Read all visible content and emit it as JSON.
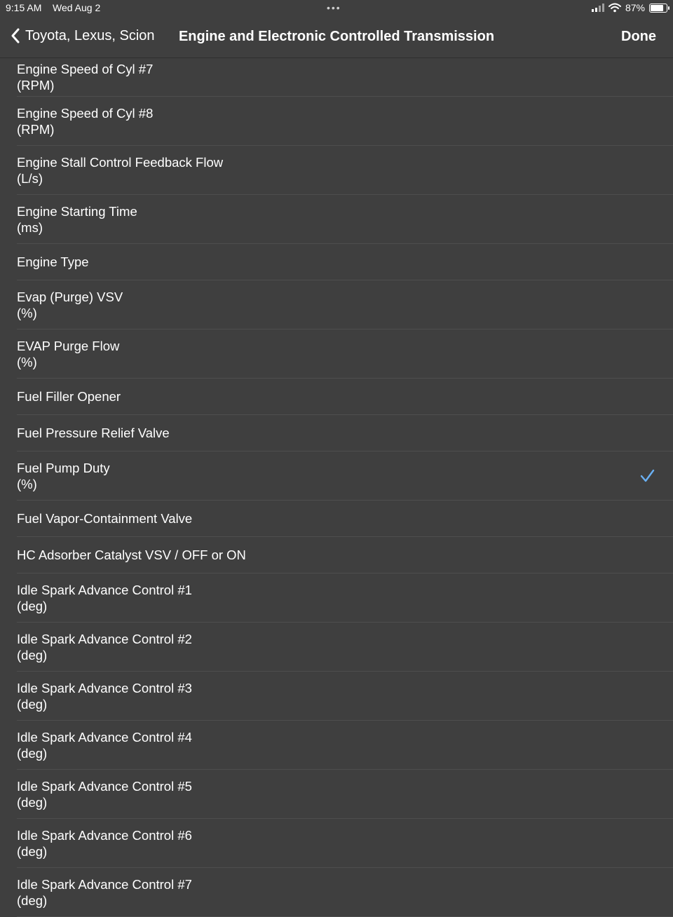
{
  "status": {
    "time": "9:15 AM",
    "date": "Wed Aug 2",
    "battery": "87%",
    "battery_level": 0.87
  },
  "nav": {
    "back_label": "Toyota, Lexus, Scion",
    "title": "Engine and Electronic Controlled Transmission",
    "done_label": "Done"
  },
  "rows": [
    {
      "label": "Engine Speed of Cyl #7",
      "unit": "(RPM)",
      "checked": false
    },
    {
      "label": "Engine Speed of Cyl #8",
      "unit": "(RPM)",
      "checked": false
    },
    {
      "label": "Engine Stall Control Feedback Flow",
      "unit": "(L/s)",
      "checked": false
    },
    {
      "label": "Engine Starting Time",
      "unit": "(ms)",
      "checked": false
    },
    {
      "label": "Engine Type",
      "unit": "",
      "checked": false
    },
    {
      "label": "Evap (Purge) VSV",
      "unit": "(%)",
      "checked": false
    },
    {
      "label": "EVAP Purge Flow",
      "unit": "(%)",
      "checked": false
    },
    {
      "label": "Fuel Filler Opener",
      "unit": "",
      "checked": false
    },
    {
      "label": "Fuel Pressure Relief Valve",
      "unit": "",
      "checked": false
    },
    {
      "label": "Fuel Pump Duty",
      "unit": "(%)",
      "checked": true
    },
    {
      "label": "Fuel Vapor-Containment Valve",
      "unit": "",
      "checked": false
    },
    {
      "label": "HC Adsorber Catalyst VSV / OFF or ON",
      "unit": "",
      "checked": false
    },
    {
      "label": "Idle Spark Advance Control #1",
      "unit": "(deg)",
      "checked": false
    },
    {
      "label": "Idle Spark Advance Control #2",
      "unit": "(deg)",
      "checked": false
    },
    {
      "label": "Idle Spark Advance Control #3",
      "unit": "(deg)",
      "checked": false
    },
    {
      "label": "Idle Spark Advance Control #4",
      "unit": "(deg)",
      "checked": false
    },
    {
      "label": "Idle Spark Advance Control #5",
      "unit": "(deg)",
      "checked": false
    },
    {
      "label": "Idle Spark Advance Control #6",
      "unit": "(deg)",
      "checked": false
    },
    {
      "label": "Idle Spark Advance Control #7",
      "unit": "(deg)",
      "checked": false
    }
  ],
  "colors": {
    "background": "#3f3f3f",
    "separator": "#4e4e4e",
    "checkmark": "#6ab0f3"
  },
  "icons": {
    "back": "chevron-left-icon",
    "check": "checkmark-icon",
    "signal": "cellular-signal-icon",
    "wifi": "wifi-icon",
    "battery": "battery-icon"
  }
}
